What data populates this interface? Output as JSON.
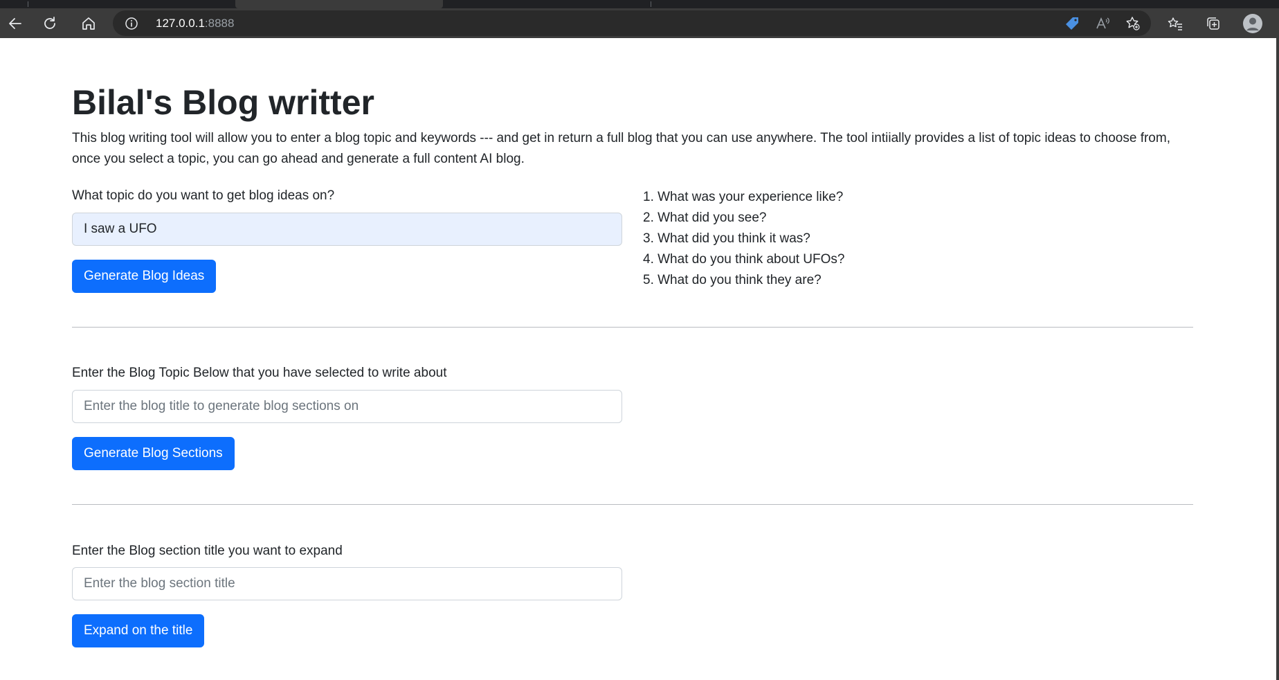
{
  "browser": {
    "url_host": "127.0.0.1",
    "url_port": ":8888",
    "icons": [
      "back-icon",
      "reload-icon",
      "home-icon",
      "info-icon",
      "tag-icon",
      "read-aloud-icon",
      "add-favorite-icon",
      "favorites-icon",
      "collections-icon",
      "profile-icon"
    ]
  },
  "page": {
    "title": "Bilal's Blog writter",
    "intro": "This blog writing tool will allow you to enter a blog topic and keywords --- and get in return a full blog that you can use anywhere. The tool intiially provides a list of topic ideas to choose from, once you select a topic, you can go ahead and generate a full content AI blog."
  },
  "ideas_form": {
    "label": "What topic do you want to get blog ideas on?",
    "value": "I saw a UFO",
    "button": "Generate Blog Ideas",
    "results": [
      "1. What was your experience like?",
      "2. What did you see?",
      "3. What did you think it was?",
      "4. What do you think about UFOs?",
      "5. What do you think they are?"
    ]
  },
  "sections_form": {
    "label": "Enter the Blog Topic Below that you have selected to write about",
    "placeholder": "Enter the blog title to generate blog sections on",
    "button": "Generate Blog Sections"
  },
  "expand_form": {
    "label": "Enter the Blog section title you want to expand",
    "placeholder": "Enter the blog section title",
    "button": "Expand on the title"
  },
  "colors": {
    "primary": "#0d6efd",
    "toolbar": "#3b3b3b",
    "autofill": "#e8f0fe",
    "text": "#212529"
  }
}
